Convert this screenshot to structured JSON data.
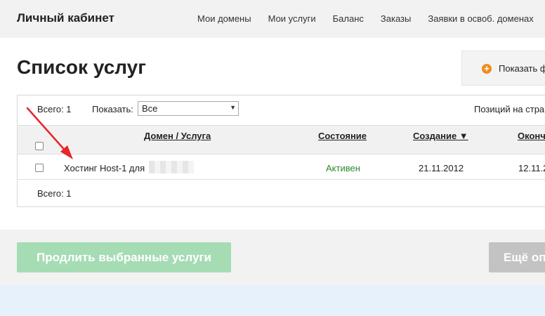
{
  "header": {
    "title": "Личный кабинет",
    "nav": [
      "Мои домены",
      "Мои услуги",
      "Баланс",
      "Заказы",
      "Заявки в освоб. доменах"
    ]
  },
  "main": {
    "title": "Список услуг",
    "filter_button": "Показать ф"
  },
  "toolbar": {
    "total": "Всего: 1",
    "show_label": "Показать:",
    "show_value": "Все",
    "per_page_label": "Позиций на стра"
  },
  "table": {
    "columns": [
      "Домен / Услуга",
      "Состояние",
      "Создание ▼",
      "Оконч"
    ],
    "rows": [
      {
        "service": "Хостинг Host-1 для",
        "status": "Активен",
        "created": "21.11.2012",
        "ends": "12.11.2"
      }
    ],
    "total": "Всего: 1"
  },
  "actions": {
    "renew_label": "Продлить выбранные услуги",
    "more_label": "Ещё оп"
  },
  "colors": {
    "status_active": "#2c8a2c",
    "renew_button": "#a6dcb4",
    "annotation_arrow": "#e8242c"
  }
}
